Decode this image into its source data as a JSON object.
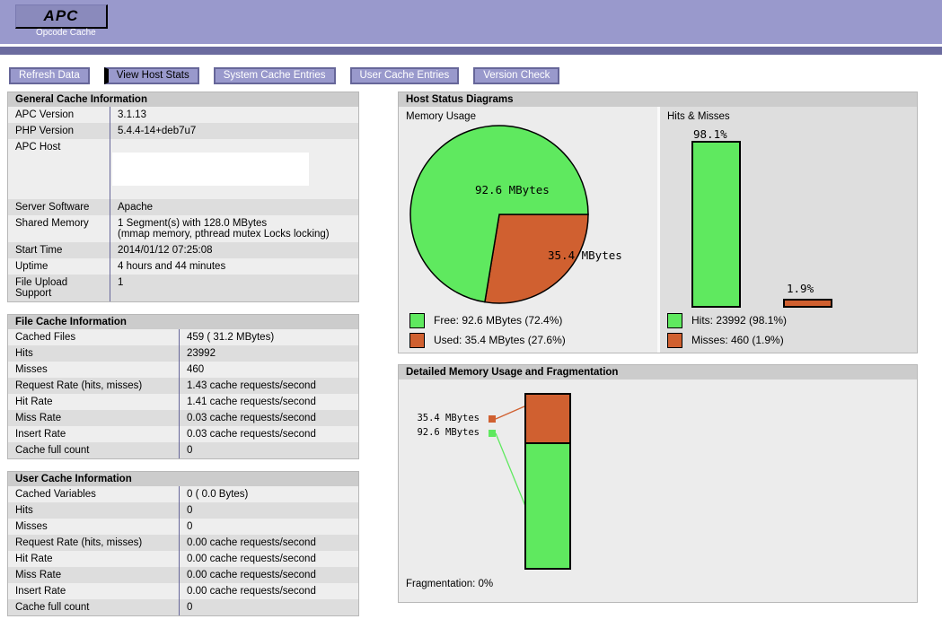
{
  "header": {
    "logo": "APC",
    "logo_subtitle": "Opcode Cache"
  },
  "nav": {
    "items": [
      {
        "label": "Refresh Data",
        "active": false
      },
      {
        "label": "View Host Stats",
        "active": true
      },
      {
        "label": "System Cache Entries",
        "active": false
      },
      {
        "label": "User Cache Entries",
        "active": false
      },
      {
        "label": "Version Check",
        "active": false
      }
    ]
  },
  "tables": {
    "general": {
      "title": "General Cache Information",
      "rows": [
        {
          "label": "APC Version",
          "value": "3.1.13"
        },
        {
          "label": "PHP Version",
          "value": "5.4.4-14+deb7u7"
        },
        {
          "label": "APC Host",
          "value": ""
        },
        {
          "label": "Server Software",
          "value": "Apache"
        },
        {
          "label": "Shared Memory",
          "value": "1 Segment(s) with 128.0 MBytes\n(mmap memory, pthread mutex Locks locking)"
        },
        {
          "label": "Start Time",
          "value": "2014/01/12 07:25:08"
        },
        {
          "label": "Uptime",
          "value": "4 hours and 44 minutes"
        },
        {
          "label": "File Upload Support",
          "value": "1"
        }
      ]
    },
    "file": {
      "title": "File Cache Information",
      "rows": [
        {
          "label": "Cached Files",
          "value": "459 ( 31.2 MBytes)"
        },
        {
          "label": "Hits",
          "value": "23992"
        },
        {
          "label": "Misses",
          "value": "460"
        },
        {
          "label": "Request Rate (hits, misses)",
          "value": "1.43 cache requests/second"
        },
        {
          "label": "Hit Rate",
          "value": "1.41 cache requests/second"
        },
        {
          "label": "Miss Rate",
          "value": "0.03 cache requests/second"
        },
        {
          "label": "Insert Rate",
          "value": "0.03 cache requests/second"
        },
        {
          "label": "Cache full count",
          "value": "0"
        }
      ]
    },
    "user": {
      "title": "User Cache Information",
      "rows": [
        {
          "label": "Cached Variables",
          "value": "0 ( 0.0 Bytes)"
        },
        {
          "label": "Hits",
          "value": "0"
        },
        {
          "label": "Misses",
          "value": "0"
        },
        {
          "label": "Request Rate (hits, misses)",
          "value": "0.00 cache requests/second"
        },
        {
          "label": "Hit Rate",
          "value": "0.00 cache requests/second"
        },
        {
          "label": "Miss Rate",
          "value": "0.00 cache requests/second"
        },
        {
          "label": "Insert Rate",
          "value": "0.00 cache requests/second"
        },
        {
          "label": "Cache full count",
          "value": "0"
        }
      ]
    }
  },
  "diagrams": {
    "title": "Host Status Diagrams"
  },
  "theme": {
    "header_band": "#9999CC",
    "header_band_dark": "#6B6B9F",
    "button_bg": "#9999CC",
    "button_border": "#666699",
    "section_header_bg": "#CCCCCC",
    "row_light": "#EEEEEE",
    "row_dark": "#DDDDDD",
    "column_divider": "#666699",
    "free_green": "#5FE95F",
    "used_red": "#D06030"
  },
  "chart_data": [
    {
      "type": "pie",
      "title": "Memory Usage",
      "slices": [
        {
          "name": "Free",
          "value_mbytes": 92.6,
          "pct": 72.4,
          "color": "#5FE95F",
          "label": "92.6 MBytes",
          "legend": "Free: 92.6 MBytes (72.4%)"
        },
        {
          "name": "Used",
          "value_mbytes": 35.4,
          "pct": 27.6,
          "color": "#D06030",
          "label": "35.4 MBytes",
          "legend": "Used: 35.4 MBytes (27.6%)"
        }
      ],
      "legend_position": "bottom"
    },
    {
      "type": "bar",
      "title": "Hits & Misses",
      "bars": [
        {
          "name": "Hits",
          "count": 23992,
          "pct": 98.1,
          "color": "#5FE95F",
          "label": "98.1%",
          "legend": "Hits: 23992 (98.1%)"
        },
        {
          "name": "Misses",
          "count": 460,
          "pct": 1.9,
          "color": "#D06030",
          "label": "1.9%",
          "legend": "Misses: 460 (1.9%)"
        }
      ],
      "ylim": [
        0,
        100
      ],
      "legend_position": "bottom"
    },
    {
      "type": "stacked-bar",
      "title": "Detailed Memory Usage and Fragmentation",
      "segments": [
        {
          "name": "Used",
          "value_mbytes": 35.4,
          "pct": 27.6,
          "color": "#D06030",
          "label": "35.4 MBytes"
        },
        {
          "name": "Free",
          "value_mbytes": 92.6,
          "pct": 72.4,
          "color": "#5FE95F",
          "label": "92.6 MBytes"
        }
      ],
      "footer": "Fragmentation: 0%"
    }
  ]
}
